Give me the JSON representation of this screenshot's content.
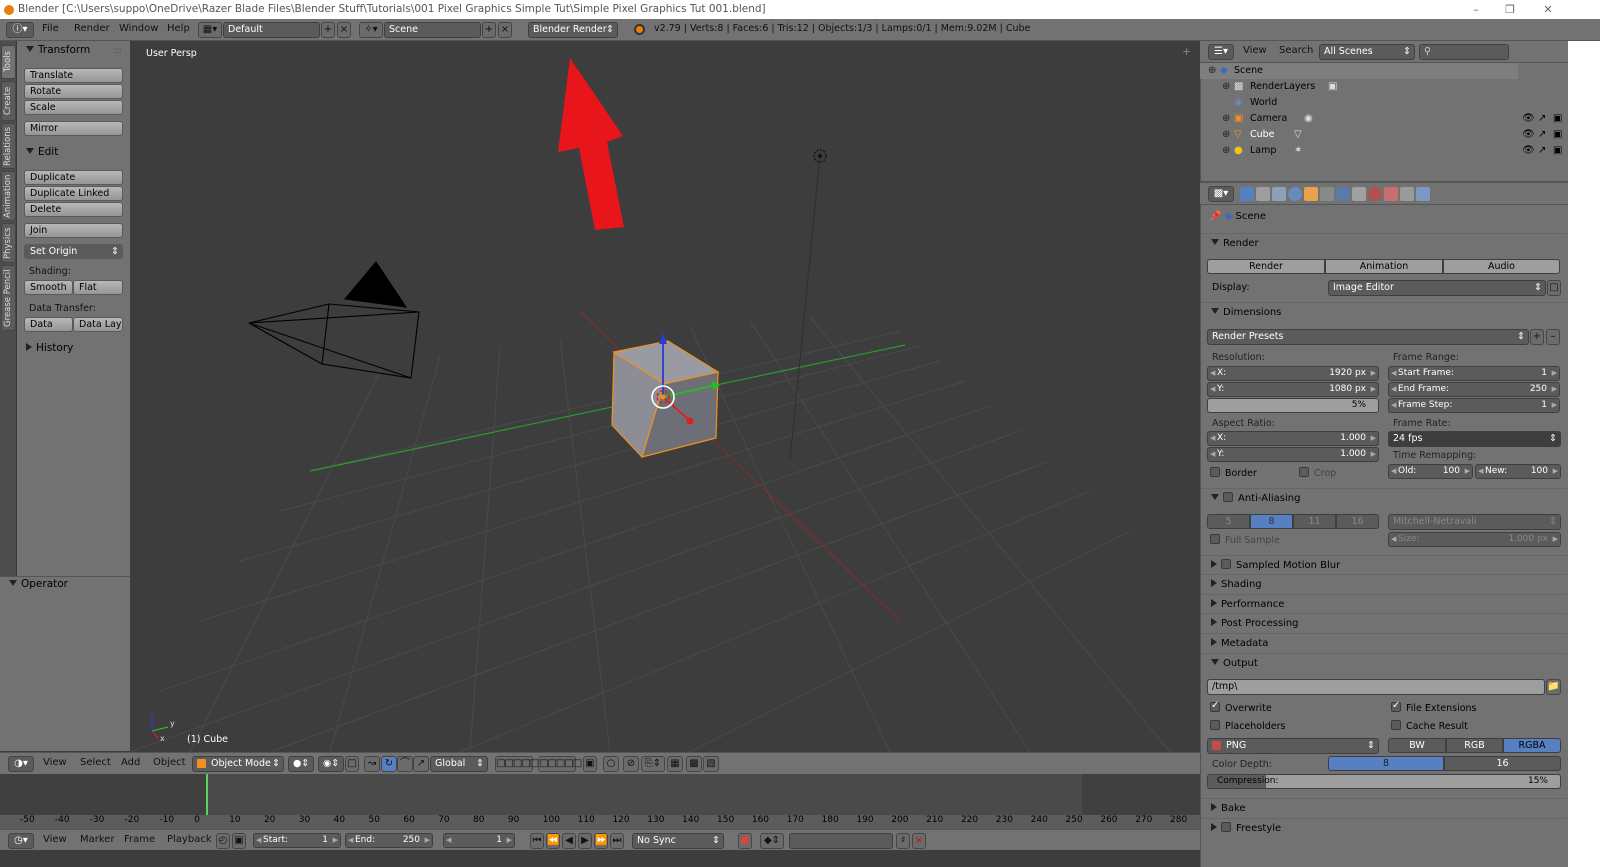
{
  "window": {
    "title": "Blender [C:\\Users\\suppo\\OneDrive\\Razer Blade Files\\Blender Stuff\\Tutorials\\001 Pixel Graphics Simple Tut\\Simple Pixel Graphics Tut 001.blend]",
    "minimize": "–",
    "maximize": "❐",
    "close": "✕"
  },
  "topbar": {
    "menus": [
      "File",
      "Render",
      "Window",
      "Help"
    ],
    "screen_layout": "Default",
    "scene": "Scene",
    "render_engine": "Blender Render",
    "stats": "v2.79 | Verts:8 | Faces:6 | Tris:12 | Objects:1/3 | Lamps:0/1 | Mem:9.02M | Cube"
  },
  "toolshelf_tabs": [
    "Tools",
    "Create",
    "Relations",
    "Animation",
    "Physics",
    "Grease Pencil"
  ],
  "tools": {
    "transform_header": "Transform",
    "translate": "Translate",
    "rotate": "Rotate",
    "scale": "Scale",
    "mirror": "Mirror",
    "edit_header": "Edit",
    "duplicate": "Duplicate",
    "duplicate_linked": "Duplicate Linked",
    "delete": "Delete",
    "join": "Join",
    "set_origin": "Set Origin",
    "shading_label": "Shading:",
    "smooth": "Smooth",
    "flat": "Flat",
    "data_transfer_label": "Data Transfer:",
    "data": "Data",
    "data_layout": "Data Layo",
    "history_header": "History",
    "operator_header": "Operator"
  },
  "viewport": {
    "view_label": "User Persp",
    "object_label": "(1) Cube"
  },
  "viewport_header": {
    "menus": [
      "View",
      "Select",
      "Add",
      "Object"
    ],
    "mode": "Object Mode",
    "orientation": "Global"
  },
  "timeline": {
    "ticks": [
      "-50",
      "-40",
      "-30",
      "-20",
      "-10",
      "0",
      "10",
      "20",
      "30",
      "40",
      "50",
      "60",
      "70",
      "80",
      "90",
      "100",
      "110",
      "120",
      "130",
      "140",
      "150",
      "160",
      "170",
      "180",
      "190",
      "200",
      "210",
      "220",
      "230",
      "240",
      "250",
      "260",
      "270",
      "280"
    ],
    "current_frame_marker": 0,
    "menus": [
      "View",
      "Marker",
      "Frame",
      "Playback"
    ],
    "start_label": "Start:",
    "start_value": "1",
    "end_label": "End:",
    "end_value": "250",
    "current_value": "1",
    "sync": "No Sync"
  },
  "outliner": {
    "menus": [
      "View",
      "Search"
    ],
    "filter": "All Scenes",
    "items": [
      {
        "name": "Scene"
      },
      {
        "name": "RenderLayers"
      },
      {
        "name": "World"
      },
      {
        "name": "Camera"
      },
      {
        "name": "Cube"
      },
      {
        "name": "Lamp"
      }
    ]
  },
  "properties": {
    "breadcrumb": "Scene",
    "render_header": "Render",
    "render_btn": "Render",
    "animation_btn": "Animation",
    "audio_btn": "Audio",
    "display_label": "Display:",
    "display_value": "Image Editor",
    "dimensions_header": "Dimensions",
    "render_presets": "Render Presets",
    "resolution_label": "Resolution:",
    "res_x_label": "X:",
    "res_x": "1920 px",
    "res_y_label": "Y:",
    "res_y": "1080 px",
    "res_pct": "5%",
    "frame_range_label": "Frame Range:",
    "start_frame_label": "Start Frame:",
    "start_frame": "1",
    "end_frame_label": "End Frame:",
    "end_frame": "250",
    "frame_step_label": "Frame Step:",
    "frame_step": "1",
    "aspect_label": "Aspect Ratio:",
    "aspect_x_label": "X:",
    "aspect_x": "1.000",
    "aspect_y_label": "Y:",
    "aspect_y": "1.000",
    "frame_rate_label": "Frame Rate:",
    "frame_rate": "24 fps",
    "time_remap_label": "Time Remapping:",
    "old_label": "Old:",
    "old": "100",
    "new_label": "New:",
    "new": "100",
    "border": "Border",
    "crop": "Crop",
    "aa_header": "Anti-Aliasing",
    "aa_samples": [
      "5",
      "8",
      "11",
      "16"
    ],
    "aa_selected": "8",
    "aa_filter": "Mitchell-Netravali",
    "full_sample": "Full Sample",
    "size_label": "Size:",
    "size_value": "1.000 px",
    "motion_blur_header": "Sampled Motion Blur",
    "shading_header": "Shading",
    "performance_header": "Performance",
    "post_processing_header": "Post Processing",
    "metadata_header": "Metadata",
    "output_header": "Output",
    "output_path": "/tmp\\",
    "overwrite": "Overwrite",
    "file_extensions": "File Extensions",
    "placeholders": "Placeholders",
    "cache_result": "Cache Result",
    "format": "PNG",
    "bw": "BW",
    "rgb": "RGB",
    "rgba": "RGBA",
    "color_depth_label": "Color Depth:",
    "depth_8": "8",
    "depth_16": "16",
    "compression_label": "Compression:",
    "compression": "15%",
    "compression_fraction": 0.15,
    "bake_header": "Bake",
    "freestyle_header": "Freestyle"
  },
  "colors": {
    "accent_blue": "#5680c2",
    "selection_orange": "#f1901e",
    "arrow_red": "#e8151b",
    "panel_gray": "#727272",
    "viewport_bg": "#3d3d3d"
  }
}
